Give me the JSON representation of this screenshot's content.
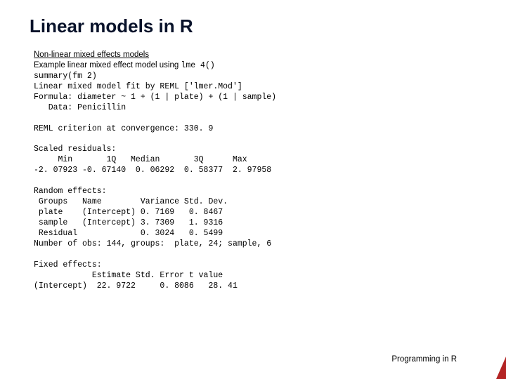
{
  "title": "Linear models in R",
  "subhead": "Non-linear mixed effects models",
  "example_prefix": "Example linear mixed effect model using ",
  "example_code": "lme 4()",
  "code": "summary(fm 2)\nLinear mixed model fit by REML ['lmer.Mod']\nFormula: diameter ~ 1 + (1 | plate) + (1 | sample)\n   Data: Penicillin\n\nREML criterion at convergence: 330. 9\n\nScaled residuals:\n     Min       1Q   Median       3Q      Max\n-2. 07923 -0. 67140  0. 06292  0. 58377  2. 97958\n\nRandom effects:\n Groups   Name        Variance Std. Dev.\n plate    (Intercept) 0. 7169   0. 8467\n sample   (Intercept) 3. 7309   1. 9316\n Residual             0. 3024   0. 5499\nNumber of obs: 144, groups:  plate, 24; sample, 6\n\nFixed effects:\n            Estimate Std. Error t value\n(Intercept)  22. 9722     0. 8086   28. 41",
  "footer": "Programming in R"
}
